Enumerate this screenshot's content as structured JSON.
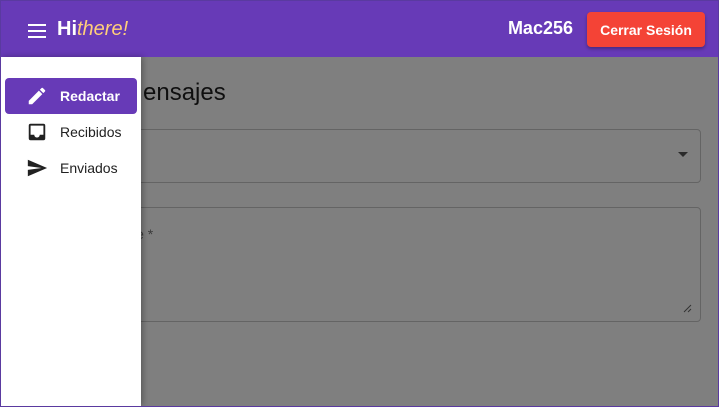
{
  "header": {
    "menu_icon": "menu-icon",
    "brand_hi": "Hi",
    "brand_there": "there!",
    "username": "Mac256",
    "logout_label": "Cerrar Sesión"
  },
  "drawer": {
    "items": [
      {
        "label": "Redactar",
        "icon": "pencil-icon",
        "active": true
      },
      {
        "label": "Recibidos",
        "icon": "inbox-icon",
        "active": false
      },
      {
        "label": "Enviados",
        "icon": "send-icon",
        "active": false
      }
    ]
  },
  "main": {
    "title_visible": "ensajes",
    "message_label_visible": "je *",
    "select_value": ""
  },
  "colors": {
    "primary": "#673ab7",
    "danger": "#f44336",
    "brand_accent": "#ffcf7a"
  }
}
